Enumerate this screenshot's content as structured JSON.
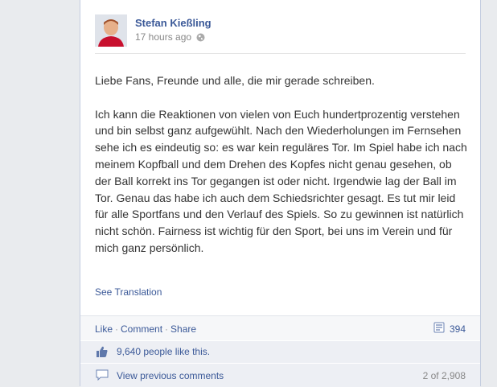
{
  "post": {
    "author": "Stefan Kießling",
    "time": "17 hours ago",
    "text": "Liebe Fans, Freunde und alle, die mir gerade schreiben.\n\nIch kann die Reaktionen von vielen von Euch hundertprozentig verstehen und bin selbst ganz aufgewühlt. Nach den Wiederholungen im Fernsehen sehe ich es eindeutig so: es war kein reguläres Tor. Im Spiel habe ich nach meinem Kopfball und dem Drehen des Kopfes nicht genau gesehen, ob der Ball korrekt ins Tor gegangen ist oder nicht. Irgendwie lag der Ball im Tor. Genau das habe ich auch dem Schiedsrichter gesagt. Es tut mir leid für alle Sportfans und den Verlauf des Spiels. So zu gewinnen ist natürlich nicht schön. Fairness ist wichtig für den Sport, bei uns im Verein und für mich ganz persönlich.",
    "see_translation": "See Translation"
  },
  "actions": {
    "like": "Like",
    "comment": "Comment",
    "share": "Share",
    "separator": "·",
    "shares_count": "394"
  },
  "likes": {
    "text": "9,640 people like this."
  },
  "comments": {
    "view_previous": "View previous comments",
    "count": "2 of 2,908"
  },
  "colors": {
    "link": "#3b5998",
    "text": "#333333",
    "meta": "#888888"
  },
  "icons": [
    "globe-icon",
    "share-count-icon",
    "thumbs-up-icon",
    "comment-bubble-icon"
  ]
}
